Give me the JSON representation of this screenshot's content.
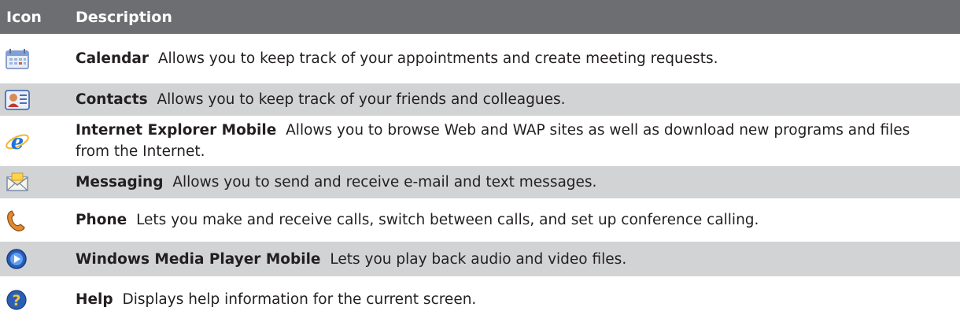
{
  "table": {
    "headers": {
      "icon": "Icon",
      "description": "Description"
    },
    "rows": [
      {
        "icon": "calendar-icon",
        "name": "Calendar",
        "text": "Allows you to keep track of your appointments and create meeting requests."
      },
      {
        "icon": "contacts-icon",
        "name": "Contacts",
        "text": "Allows you to keep track of your friends and colleagues."
      },
      {
        "icon": "internet-explorer-icon",
        "name": "Internet Explorer Mobile",
        "text": "Allows you to browse Web and WAP sites as well as download new programs and files from the Internet."
      },
      {
        "icon": "messaging-envelope-icon",
        "name": "Messaging",
        "text": "Allows you to send and receive e-mail and text messages."
      },
      {
        "icon": "phone-handset-icon",
        "name": "Phone",
        "text": "Lets you make and receive calls, switch between calls, and set up conference calling."
      },
      {
        "icon": "media-player-icon",
        "name": "Windows Media Player Mobile",
        "text": "Lets you play back audio and video files."
      },
      {
        "icon": "help-question-icon",
        "name": "Help",
        "text": "Displays help information for the current screen."
      }
    ]
  },
  "colors": {
    "header_bg": "#6d6e71",
    "alt_row_bg": "#d1d3d4",
    "text": "#231f20"
  }
}
